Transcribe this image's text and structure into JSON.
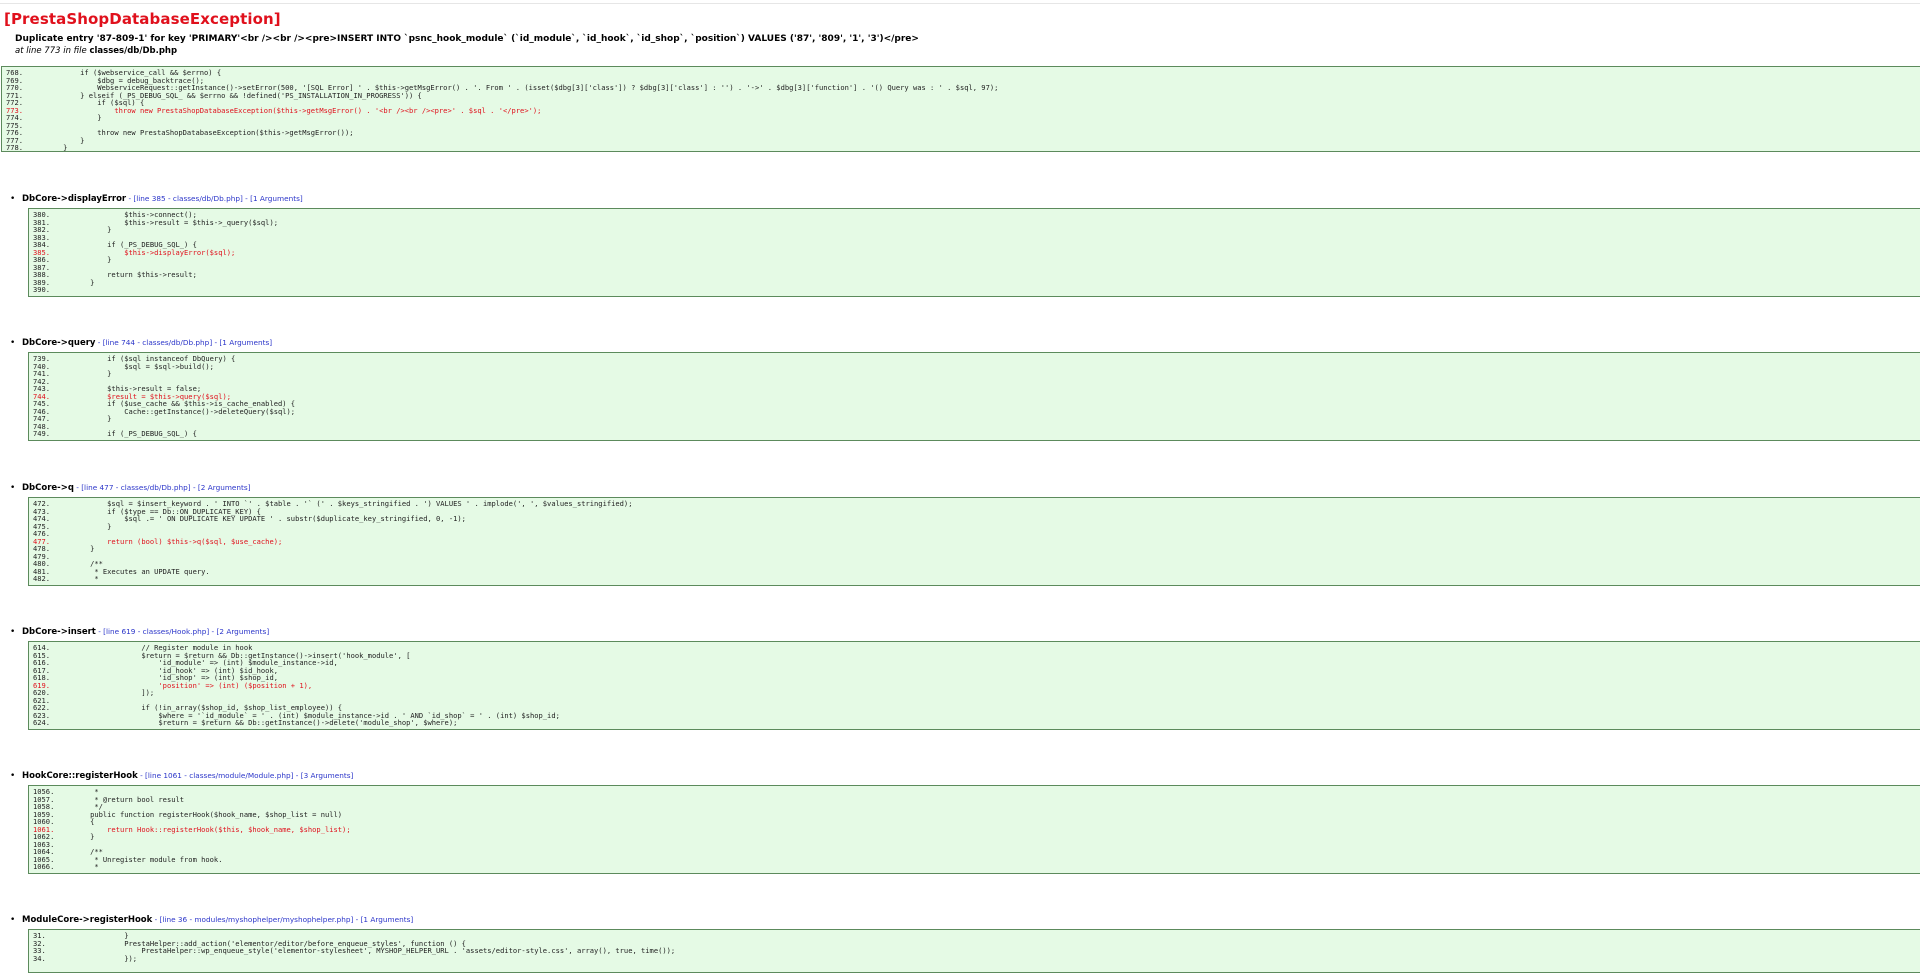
{
  "exception": {
    "title": "[PrestaShopDatabaseException]",
    "message": "Duplicate entry '87-809-1' for key 'PRIMARY'<br /><br /><pre>INSERT INTO `psnc_hook_module` (`id_module`, `id_hook`, `id_shop`, `position`) VALUES ('87', '809', '1', '3')</pre>",
    "location_prefix": "at line ",
    "location_line": "773",
    "location_mid": " in file ",
    "location_file": "classes/db/Db.php"
  },
  "main_code": [
    {
      "n": "768.",
      "t": "        if ($webservice_call && $errno) {",
      "hl": false
    },
    {
      "n": "769.",
      "t": "            $dbg = debug_backtrace();",
      "hl": false
    },
    {
      "n": "770.",
      "t": "            WebserviceRequest::getInstance()->setError(500, '[SQL Error] ' . $this->getMsgError() . '. From ' . (isset($dbg[3]['class']) ? $dbg[3]['class'] : '') . '->' . $dbg[3]['function'] . '() Query was : ' . $sql, 97);",
      "hl": false
    },
    {
      "n": "771.",
      "t": "        } elseif (_PS_DEBUG_SQL_ && $errno && !defined('PS_INSTALLATION_IN_PROGRESS')) {",
      "hl": false
    },
    {
      "n": "772.",
      "t": "            if ($sql) {",
      "hl": false
    },
    {
      "n": "773.",
      "t": "                throw new PrestaShopDatabaseException($this->getMsgError() . '<br /><br /><pre>' . $sql . '</pre>');",
      "hl": true
    },
    {
      "n": "774.",
      "t": "            }",
      "hl": false
    },
    {
      "n": "775.",
      "t": "",
      "hl": false
    },
    {
      "n": "776.",
      "t": "            throw new PrestaShopDatabaseException($this->getMsgError());",
      "hl": false
    },
    {
      "n": "777.",
      "t": "        }",
      "hl": false
    },
    {
      "n": "778.",
      "t": "    }",
      "hl": false
    }
  ],
  "frames": [
    {
      "fn": "DbCore->displayError",
      "meta": " - [line 385 - classes/db/Db.php] - [1 Arguments]",
      "code": [
        {
          "n": "380.",
          "t": "            $this->connect();",
          "hl": false
        },
        {
          "n": "381.",
          "t": "            $this->result = $this->_query($sql);",
          "hl": false
        },
        {
          "n": "382.",
          "t": "        }",
          "hl": false
        },
        {
          "n": "383.",
          "t": "",
          "hl": false
        },
        {
          "n": "384.",
          "t": "        if (_PS_DEBUG_SQL_) {",
          "hl": false
        },
        {
          "n": "385.",
          "t": "            $this->displayError($sql);",
          "hl": true
        },
        {
          "n": "386.",
          "t": "        }",
          "hl": false
        },
        {
          "n": "387.",
          "t": "",
          "hl": false
        },
        {
          "n": "388.",
          "t": "        return $this->result;",
          "hl": false
        },
        {
          "n": "389.",
          "t": "    }",
          "hl": false
        },
        {
          "n": "390.",
          "t": "",
          "hl": false
        }
      ]
    },
    {
      "fn": "DbCore->query",
      "meta": " - [line 744 - classes/db/Db.php] - [1 Arguments]",
      "code": [
        {
          "n": "739.",
          "t": "        if ($sql instanceof DbQuery) {",
          "hl": false
        },
        {
          "n": "740.",
          "t": "            $sql = $sql->build();",
          "hl": false
        },
        {
          "n": "741.",
          "t": "        }",
          "hl": false
        },
        {
          "n": "742.",
          "t": "",
          "hl": false
        },
        {
          "n": "743.",
          "t": "        $this->result = false;",
          "hl": false
        },
        {
          "n": "744.",
          "t": "        $result = $this->query($sql);",
          "hl": true
        },
        {
          "n": "745.",
          "t": "        if ($use_cache && $this->is_cache_enabled) {",
          "hl": false
        },
        {
          "n": "746.",
          "t": "            Cache::getInstance()->deleteQuery($sql);",
          "hl": false
        },
        {
          "n": "747.",
          "t": "        }",
          "hl": false
        },
        {
          "n": "748.",
          "t": "",
          "hl": false
        },
        {
          "n": "749.",
          "t": "        if (_PS_DEBUG_SQL_) {",
          "hl": false
        }
      ]
    },
    {
      "fn": "DbCore->q",
      "meta": " - [line 477 - classes/db/Db.php] - [2 Arguments]",
      "code": [
        {
          "n": "472.",
          "t": "        $sql = $insert_keyword . ' INTO `' . $table . '` (' . $keys_stringified . ') VALUES ' . implode(', ', $values_stringified);",
          "hl": false
        },
        {
          "n": "473.",
          "t": "        if ($type == Db::ON_DUPLICATE_KEY) {",
          "hl": false
        },
        {
          "n": "474.",
          "t": "            $sql .= ' ON DUPLICATE KEY UPDATE ' . substr($duplicate_key_stringified, 0, -1);",
          "hl": false
        },
        {
          "n": "475.",
          "t": "        }",
          "hl": false
        },
        {
          "n": "476.",
          "t": "",
          "hl": false
        },
        {
          "n": "477.",
          "t": "        return (bool) $this->q($sql, $use_cache);",
          "hl": true
        },
        {
          "n": "478.",
          "t": "    }",
          "hl": false
        },
        {
          "n": "479.",
          "t": "",
          "hl": false
        },
        {
          "n": "480.",
          "t": "    /**",
          "hl": false
        },
        {
          "n": "481.",
          "t": "     * Executes an UPDATE query.",
          "hl": false
        },
        {
          "n": "482.",
          "t": "     *",
          "hl": false
        }
      ]
    },
    {
      "fn": "DbCore->insert",
      "meta": " - [line 619 - classes/Hook.php] - [2 Arguments]",
      "code": [
        {
          "n": "614.",
          "t": "                // Register module in hook",
          "hl": false
        },
        {
          "n": "615.",
          "t": "                $return = $return && Db::getInstance()->insert('hook_module', [",
          "hl": false
        },
        {
          "n": "616.",
          "t": "                    'id_module' => (int) $module_instance->id,",
          "hl": false
        },
        {
          "n": "617.",
          "t": "                    'id_hook' => (int) $id_hook,",
          "hl": false
        },
        {
          "n": "618.",
          "t": "                    'id_shop' => (int) $shop_id,",
          "hl": false
        },
        {
          "n": "619.",
          "t": "                    'position' => (int) ($position + 1),",
          "hl": true
        },
        {
          "n": "620.",
          "t": "                ]);",
          "hl": false
        },
        {
          "n": "621.",
          "t": "",
          "hl": false
        },
        {
          "n": "622.",
          "t": "                if (!in_array($shop_id, $shop_list_employee)) {",
          "hl": false
        },
        {
          "n": "623.",
          "t": "                    $where = '`id_module` = ' . (int) $module_instance->id . ' AND `id_shop` = ' . (int) $shop_id;",
          "hl": false
        },
        {
          "n": "624.",
          "t": "                    $return = $return && Db::getInstance()->delete('module_shop', $where);",
          "hl": false
        }
      ]
    },
    {
      "fn": "HookCore::registerHook",
      "meta": " - [line 1061 - classes/module/Module.php] - [3 Arguments]",
      "code": [
        {
          "n": "1056.",
          "t": "     *",
          "hl": false
        },
        {
          "n": "1057.",
          "t": "     * @return bool result",
          "hl": false
        },
        {
          "n": "1058.",
          "t": "     */",
          "hl": false
        },
        {
          "n": "1059.",
          "t": "    public function registerHook($hook_name, $shop_list = null)",
          "hl": false
        },
        {
          "n": "1060.",
          "t": "    {",
          "hl": false
        },
        {
          "n": "1061.",
          "t": "        return Hook::registerHook($this, $hook_name, $shop_list);",
          "hl": true
        },
        {
          "n": "1062.",
          "t": "    }",
          "hl": false
        },
        {
          "n": "1063.",
          "t": "",
          "hl": false
        },
        {
          "n": "1064.",
          "t": "    /**",
          "hl": false
        },
        {
          "n": "1065.",
          "t": "     * Unregister module from hook.",
          "hl": false
        },
        {
          "n": "1066.",
          "t": "     *",
          "hl": false
        }
      ]
    },
    {
      "fn": "ModuleCore->registerHook",
      "meta": " - [line 36 - modules/myshophelper/myshophelper.php] - [1 Arguments]",
      "code": [
        {
          "n": "31.",
          "t": "            }",
          "hl": false
        },
        {
          "n": "32.",
          "t": "            PrestaHelper::add_action('elementor/editor/before_enqueue_styles', function () {",
          "hl": false
        },
        {
          "n": "33.",
          "t": "                PrestaHelper::wp_enqueue_style('elementor-stylesheet', MYSHOP_HELPER_URL . 'assets/editor-style.css', array(), true, time());",
          "hl": false
        },
        {
          "n": "34.",
          "t": "            });",
          "hl": false
        }
      ]
    }
  ]
}
